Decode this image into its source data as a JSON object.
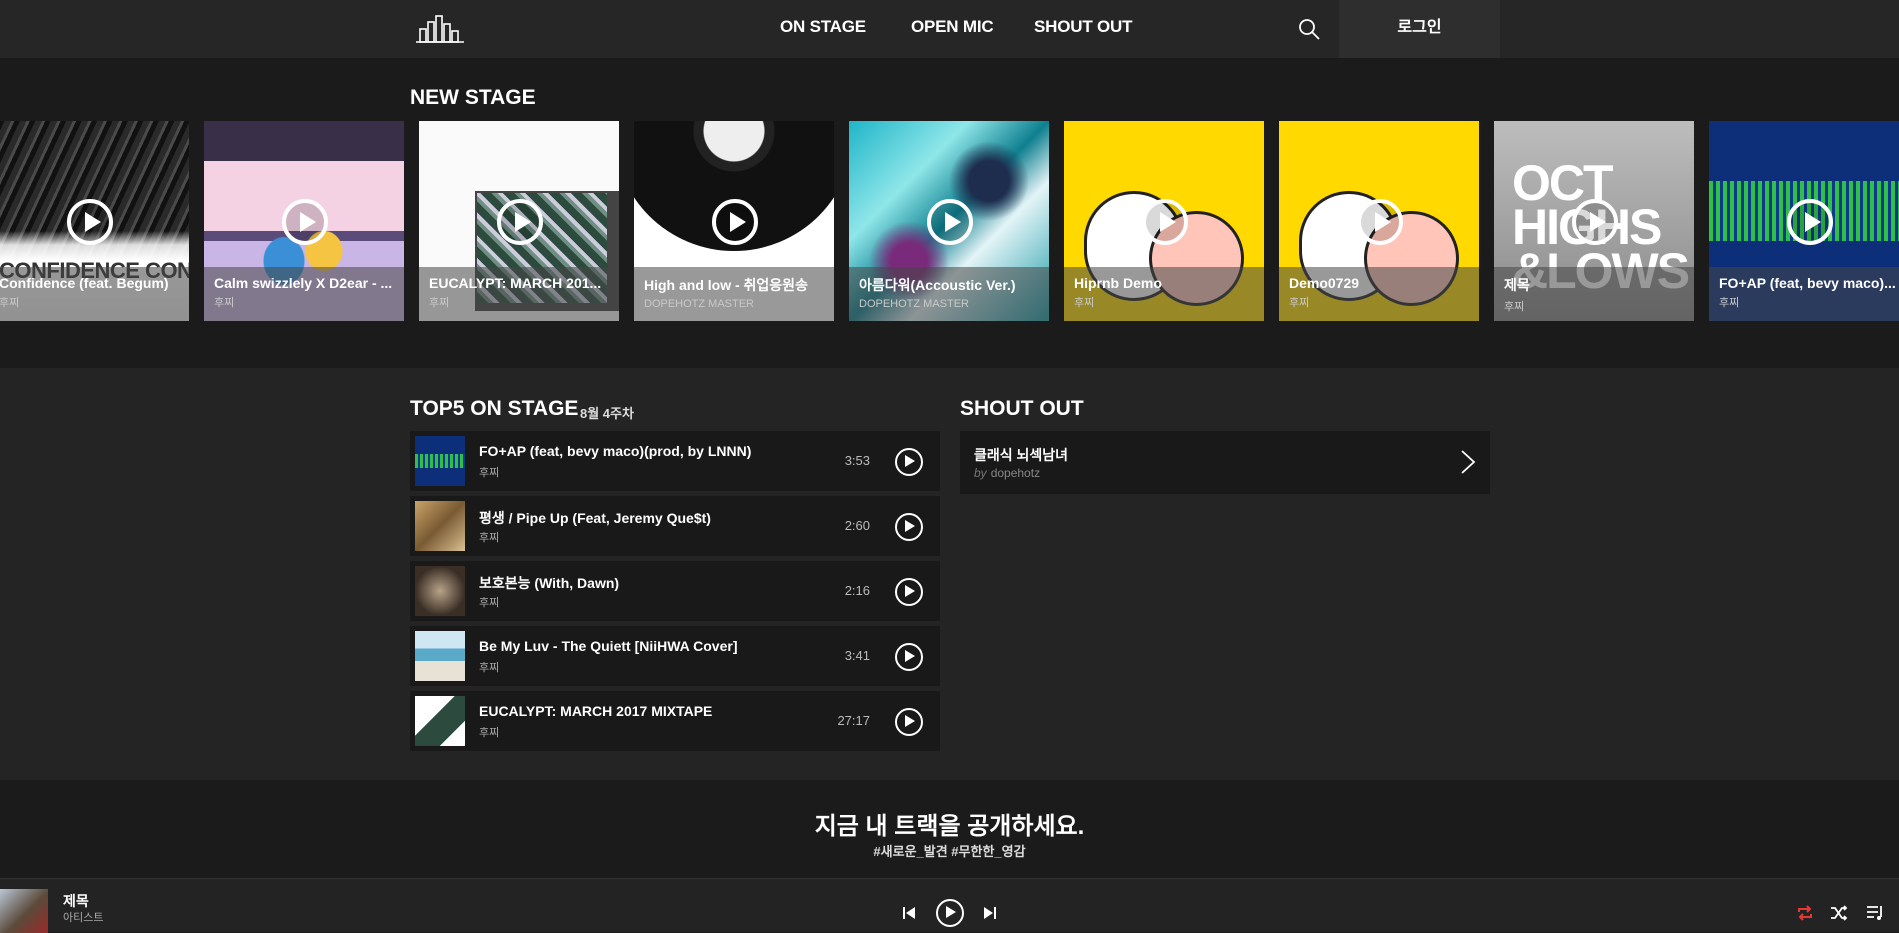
{
  "nav": {
    "items": [
      "ON STAGE",
      "OPEN MIC",
      "SHOUT OUT"
    ],
    "login": "로그인"
  },
  "new_stage": {
    "title": "NEW STAGE",
    "cards": [
      {
        "title": "Confidence (feat. Begum)",
        "artist": "후찌",
        "bg_text": "CONFIDENCE CONFIDENCE"
      },
      {
        "title": "Calm swizzlely X D2ear - ...",
        "artist": "후찌"
      },
      {
        "title": "EUCALYPT: MARCH 201...",
        "artist": "후찌"
      },
      {
        "title": "High and low - 취업응원송",
        "artist": "DOPEHOTZ MASTER"
      },
      {
        "title": "아름다워(Accoustic Ver.)",
        "artist": "DOPEHOTZ MASTER"
      },
      {
        "title": "Hiprnb Demo",
        "artist": "후찌"
      },
      {
        "title": "Demo0729",
        "artist": "후찌"
      },
      {
        "title": "제목",
        "artist": "후찌",
        "bg_text": "OCT HIGHS &LOWS"
      },
      {
        "title": "FO+AP (feat, bevy maco)...",
        "artist": "후찌"
      }
    ]
  },
  "top5": {
    "title": "TOP5 ON STAGE",
    "week": "8월 4주차",
    "rows": [
      {
        "title": "FO+AP (feat, bevy maco)(prod, by LNNN)",
        "artist": "후찌",
        "duration": "3:53"
      },
      {
        "title": "평생      / Pipe Up (Feat, Jeremy Que$t)",
        "artist": "후찌",
        "duration": "2:60"
      },
      {
        "title": "보호본능 (With, Dawn)",
        "artist": "후찌",
        "duration": "2:16"
      },
      {
        "title": "Be My Luv - The Quiett [NiiHWA Cover]",
        "artist": "후찌",
        "duration": "3:41"
      },
      {
        "title": "EUCALYPT: MARCH 2017 MIXTAPE",
        "artist": "후찌",
        "duration": "27:17"
      }
    ]
  },
  "shout_out": {
    "title": "SHOUT OUT",
    "item": {
      "title": "클래식 뇌섹남녀",
      "by": "by",
      "author": "dopehotz"
    }
  },
  "promo": {
    "title": "지금 내 트랙을 공개하세요.",
    "tags": "#새로운_발견 #무한한_영감"
  },
  "player": {
    "title": "제목",
    "artist": "아티스트",
    "repeat_color": "#e53935"
  }
}
